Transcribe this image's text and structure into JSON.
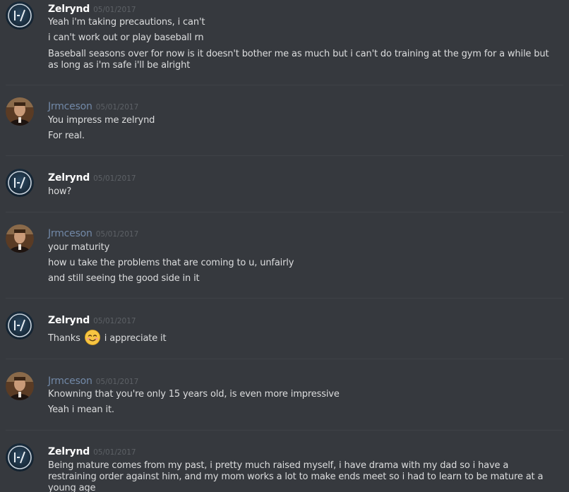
{
  "messages": [
    {
      "author": "Zelrynd",
      "timestamp": "05/01/2017",
      "lines": [
        "Yeah i'm taking precautions, i can't",
        "i can't work out or play baseball rn",
        "Baseball seasons over for now is it doesn't bother me as much but i can't do training at the gym for a while but as long as i'm safe i'll be alright"
      ]
    },
    {
      "author": "Jrmceson",
      "timestamp": "05/01/2017",
      "lines": [
        "You impress me zelrynd",
        "For real."
      ]
    },
    {
      "author": "Zelrynd",
      "timestamp": "05/01/2017",
      "lines": [
        "how?"
      ]
    },
    {
      "author": "Jrmceson",
      "timestamp": "05/01/2017",
      "lines": [
        "your maturity",
        "how u take the problems that are coming to u, unfairly",
        "and still seeing the good side in it"
      ]
    },
    {
      "author": "Zelrynd",
      "timestamp": "05/01/2017",
      "line_before_emoji": "Thanks",
      "line_after_emoji": "i appreciate it",
      "emoji": "smiling-blush-emoji"
    },
    {
      "author": "Jrmceson",
      "timestamp": "05/01/2017",
      "lines": [
        "Knowning that you're only 15 years old, is even more impressive",
        "Yeah i mean it."
      ]
    },
    {
      "author": "Zelrynd",
      "timestamp": "05/01/2017",
      "lines": [
        "Being mature comes from my past, i pretty much raised myself, i have drama with my dad so i have a restraining order against him, and my mom works a lot to make ends meet so i had to learn to be mature at a young age"
      ]
    }
  ],
  "colors": {
    "background": "#36393e",
    "divider": "#3f4247",
    "text": "#dcddde",
    "username_zelrynd": "#ffffff",
    "username_jrmceson": "#7289a8",
    "timestamp": "#5d6166"
  }
}
